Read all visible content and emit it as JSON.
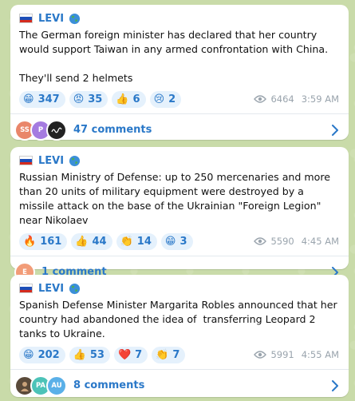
{
  "posts": [
    {
      "author": "LEVI",
      "text": "The German foreign minister has declared that her country would support Taiwan in any armed confrontation with China.\n\nThey'll send 2 helmets",
      "reactions": [
        {
          "emoji": "😁",
          "count": "347"
        },
        {
          "emoji": "😡",
          "count": "35"
        },
        {
          "emoji": "👍",
          "count": "6"
        },
        {
          "emoji": "😢",
          "count": "2"
        }
      ],
      "views": "6464",
      "time": "3:59 AM",
      "avatars": [
        {
          "initials": "SS",
          "color": "#e9866a"
        },
        {
          "initials": "P",
          "color": "#a57be0"
        },
        {
          "initials": "",
          "color": "#222222"
        }
      ],
      "comments_label": "47 comments"
    },
    {
      "author": "LEVI",
      "text": "Russian Ministry of Defense: up to 250 mercenaries and more than 20 units of military equipment were destroyed by a missile attack on the base of the Ukrainian \"Foreign Legion\" near Nikolaev",
      "reactions": [
        {
          "emoji": "🔥",
          "count": "161"
        },
        {
          "emoji": "👍",
          "count": "44"
        },
        {
          "emoji": "👏",
          "count": "14"
        },
        {
          "emoji": "😁",
          "count": "3"
        }
      ],
      "views": "5590",
      "time": "4:45 AM",
      "avatars": [
        {
          "initials": "E",
          "color": "#f29c78"
        }
      ],
      "comments_label": "1 comment"
    },
    {
      "author": "LEVI",
      "text": "Spanish Defense Minister Margarita Robles announced that her country had abandoned the idea of  transferring Leopard 2 tanks to Ukraine.",
      "reactions": [
        {
          "emoji": "😁",
          "count": "202"
        },
        {
          "emoji": "👍",
          "count": "53"
        },
        {
          "emoji": "❤️",
          "count": "7"
        },
        {
          "emoji": "👏",
          "count": "7"
        }
      ],
      "views": "5991",
      "time": "4:55 AM",
      "avatars": [
        {
          "initials": "",
          "color": "#5a4a3a"
        },
        {
          "initials": "PA",
          "color": "#4cc3b8"
        },
        {
          "initials": "AU",
          "color": "#5ab0e8"
        }
      ],
      "comments_label": "8 comments"
    }
  ],
  "icons": {
    "views": "eye-icon",
    "verified": "globe-icon",
    "open_comments": "chevron-right-icon"
  },
  "colors": {
    "accent": "#2a78c8",
    "reaction_bg": "#e5f1fc",
    "meta": "#9aa4ad",
    "background": "#c9dba9"
  }
}
